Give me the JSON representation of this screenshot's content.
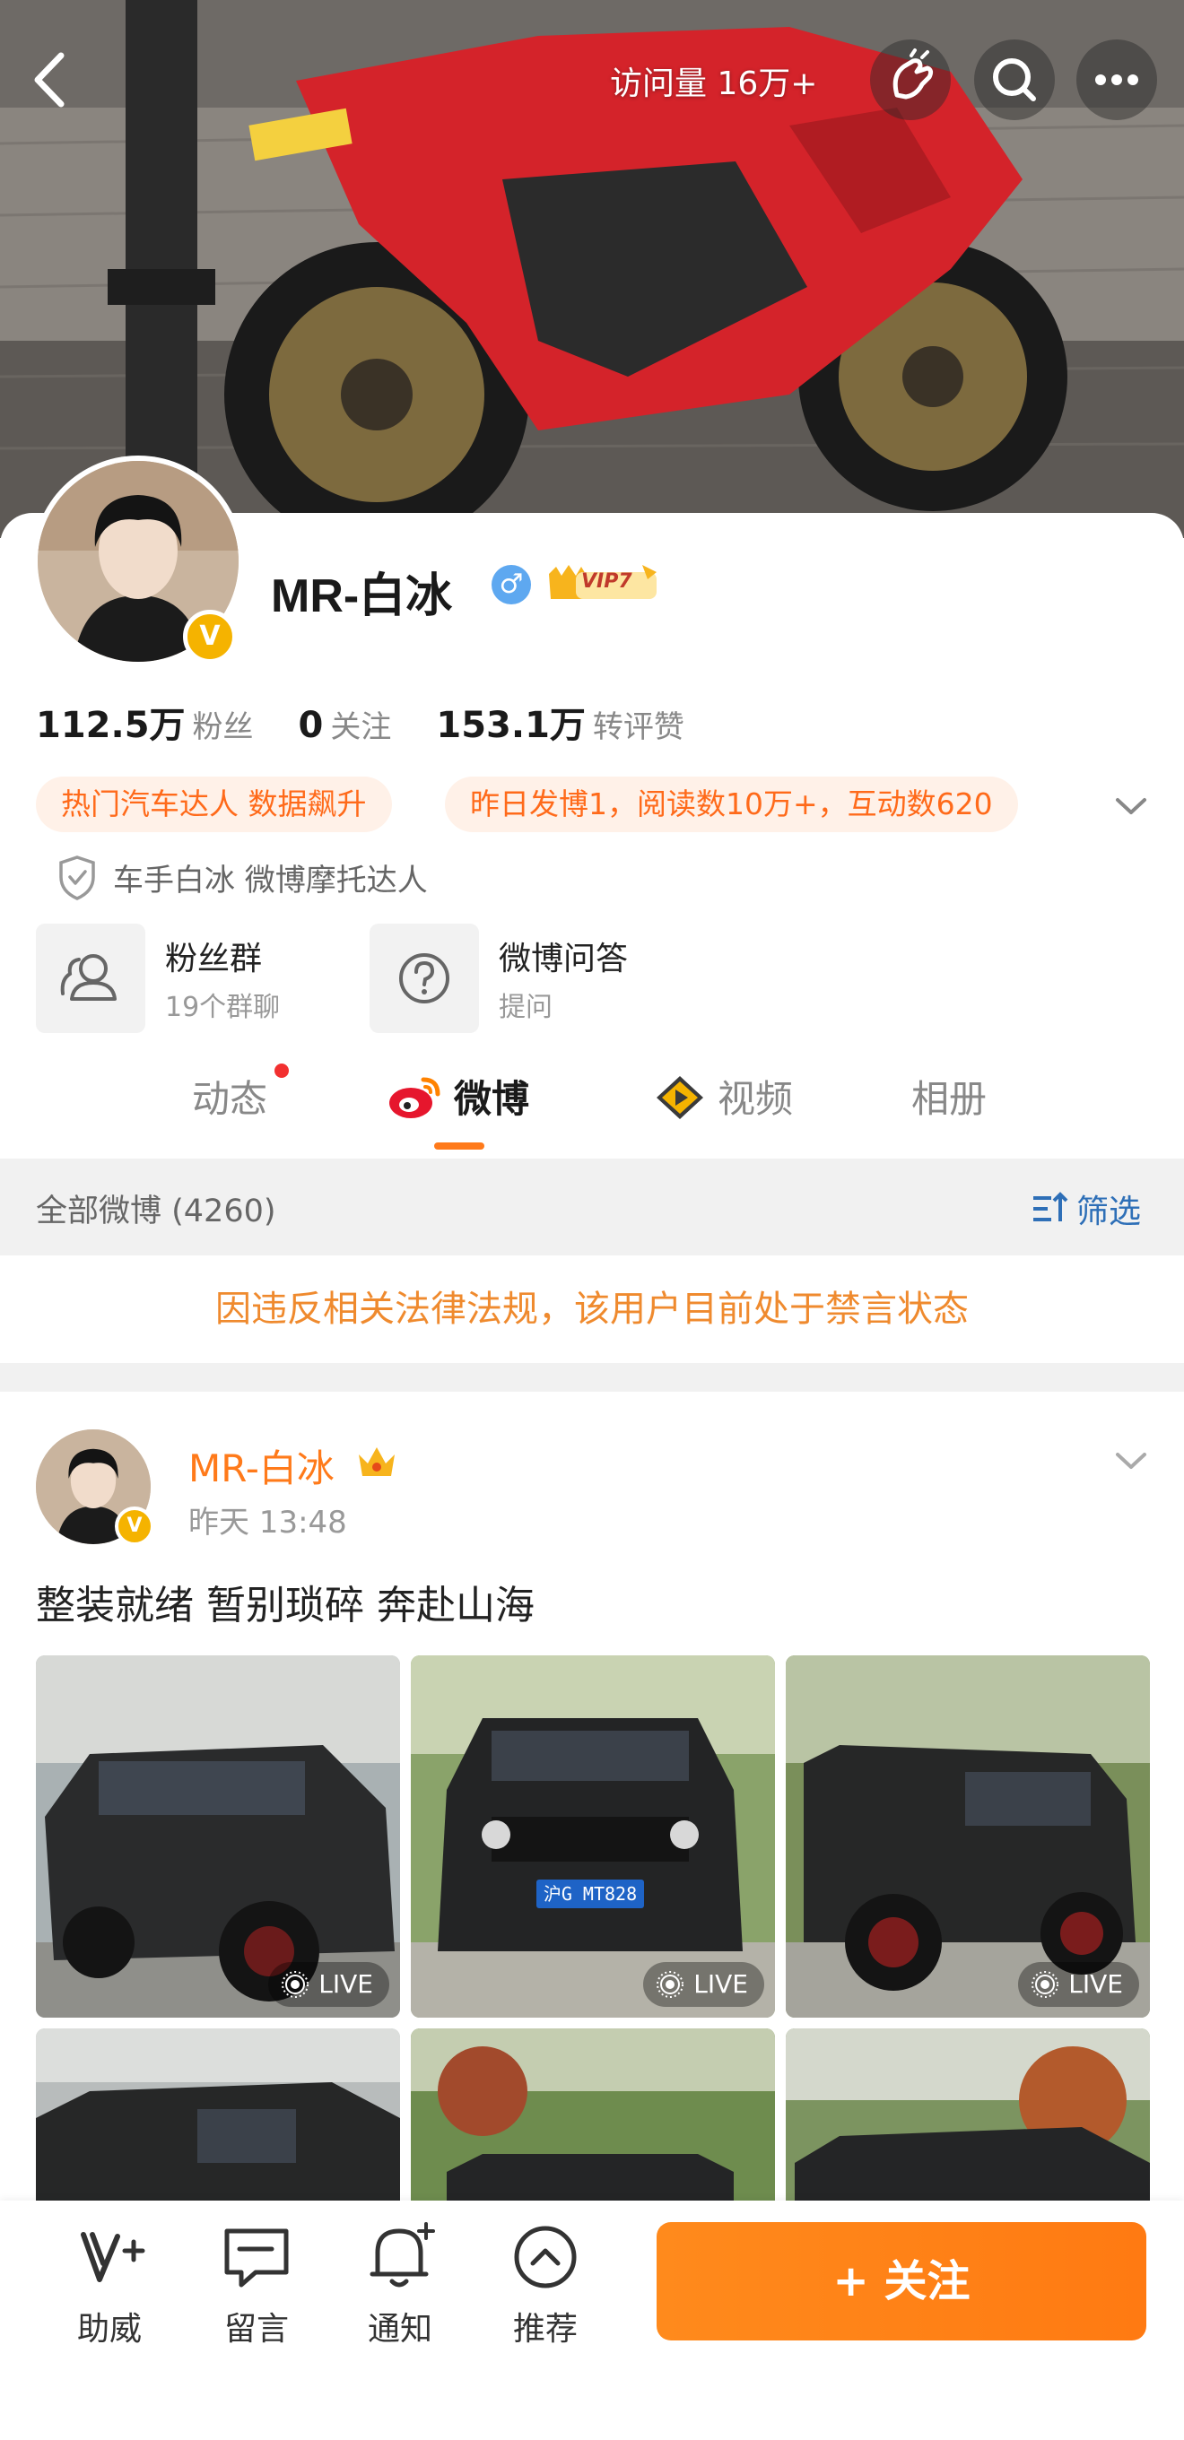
{
  "header": {
    "visit_count": "访问量 16万+"
  },
  "profile": {
    "nickname": "MR-白冰",
    "verified_badge": "V",
    "gender": "♂",
    "vip_label": "VIP7",
    "stats": [
      {
        "value": "112.5万",
        "label": "粉丝"
      },
      {
        "value": "0",
        "label": "关注"
      },
      {
        "value": "153.1万",
        "label": "转评赞"
      }
    ],
    "tags": [
      "热门汽车达人 数据飙升",
      "昨日发博1，阅读数10万+，互动数620"
    ],
    "certification": "车手白冰 微博摩托达人",
    "entries": [
      {
        "title": "粉丝群",
        "sub": "19个群聊",
        "icon": "users-icon"
      },
      {
        "title": "微博问答",
        "sub": "提问",
        "icon": "question-icon"
      }
    ]
  },
  "tabs": [
    "动态",
    "微博",
    "视频",
    "相册"
  ],
  "feed": {
    "filter_title": "全部微博 (4260)",
    "filter_label": "筛选",
    "ban_notice": "因违反相关法律法规，该用户目前处于禁言状态"
  },
  "post": {
    "author": "MR-白冰",
    "time": "昨天 13:48",
    "text": "整装就绪 暂别琐碎 奔赴山海",
    "live_label": "LIVE",
    "plate_text": "沪G MT828"
  },
  "bottom_bar": {
    "items": [
      {
        "label": "助威",
        "icon": "cheer-icon"
      },
      {
        "label": "留言",
        "icon": "message-icon"
      },
      {
        "label": "通知",
        "icon": "bell-icon"
      },
      {
        "label": "推荐",
        "icon": "recommend-icon"
      }
    ],
    "follow_label": "+ 关注"
  },
  "colors": {
    "accent_orange": "#ff7a1a",
    "tag_bg": "#fff1e8",
    "ban_text": "#ef8a2e",
    "link_blue": "#2e6fb7"
  }
}
